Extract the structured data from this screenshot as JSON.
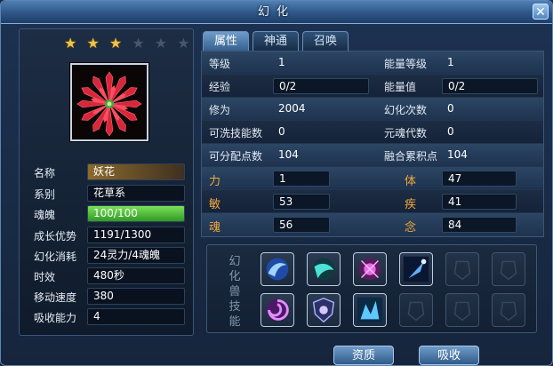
{
  "window": {
    "title": "幻化"
  },
  "left": {
    "stars": {
      "filled": 3,
      "total": 6
    },
    "portrait_icon": "red-flower-portrait",
    "rows": [
      {
        "label": "名称",
        "value": "妖花"
      },
      {
        "label": "系别",
        "value": "花草系"
      },
      {
        "label": "魂魄",
        "value": "100/100",
        "fill": 1.0
      },
      {
        "label": "成长优势",
        "value": "1191/1300"
      },
      {
        "label": "幻化消耗",
        "value": "24灵力/4魂魄"
      },
      {
        "label": "时效",
        "value": "480秒"
      },
      {
        "label": "移动速度",
        "value": "380"
      },
      {
        "label": "吸收能力",
        "value": "4"
      }
    ]
  },
  "tabs": [
    {
      "label": "属性",
      "active": true
    },
    {
      "label": "神通",
      "active": false
    },
    {
      "label": "召唤",
      "active": false
    }
  ],
  "stats": {
    "rows": [
      {
        "l1": "等级",
        "v1": "1",
        "l2": "能量等级",
        "v2": "1"
      },
      {
        "l1": "经验",
        "v1": "0/2",
        "l2": "能量值",
        "v2": "0/2"
      },
      {
        "l1": "修为",
        "v1": "2004",
        "l2": "幻化次数",
        "v2": "0"
      },
      {
        "l1": "可洗技能数",
        "v1": "0",
        "l2": "元魂代数",
        "v2": "0"
      },
      {
        "l1": "可分配点数",
        "v1": "104",
        "l2": "融合累积点",
        "v2": "104"
      },
      {
        "l1": "力",
        "v1": "1",
        "l2": "体",
        "v2": "47"
      },
      {
        "l1": "敏",
        "v1": "53",
        "l2": "疾",
        "v2": "41"
      },
      {
        "l1": "魂",
        "v1": "56",
        "l2": "念",
        "v2": "84"
      }
    ]
  },
  "skills": {
    "label": "幻化兽技能",
    "slots": [
      "blue-wind-skill-icon",
      "teal-wave-skill-icon",
      "purple-orb-skill-icon",
      "blue-comet-skill-icon",
      "empty-slot-icon",
      "empty-slot-icon",
      "purple-swirl-skill-icon",
      "shield-skill-icon",
      "ice-beast-skill-icon",
      "empty-slot-icon",
      "empty-slot-icon",
      "empty-slot-icon"
    ]
  },
  "buttons": {
    "aptitude": "资质",
    "absorb": "吸收"
  },
  "colors": {
    "accent": "#f2a73a",
    "bar": "#4fc03a",
    "panel": "#16253b"
  }
}
